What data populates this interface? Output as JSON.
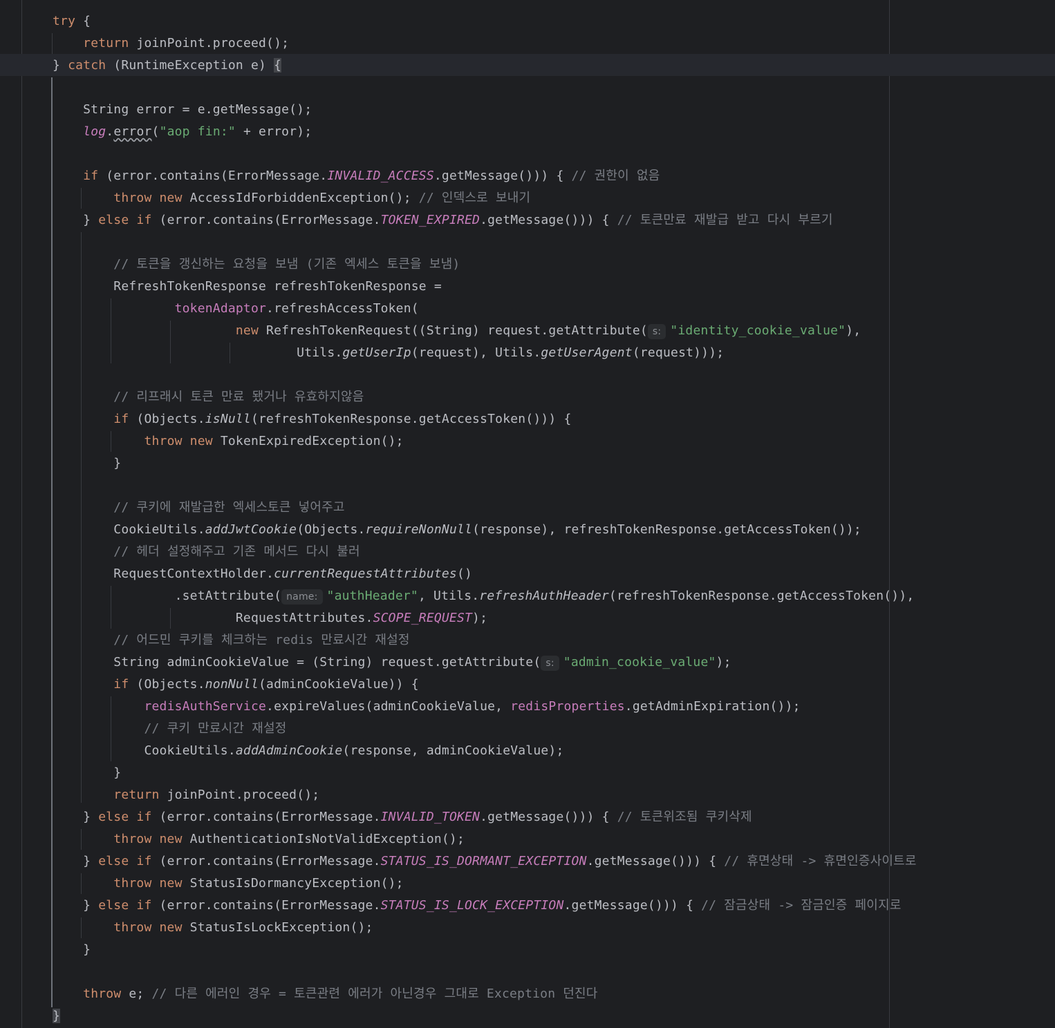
{
  "lines": [
    [
      {
        "t": "try",
        "c": "kw"
      },
      {
        "t": " {"
      }
    ],
    [
      {
        "t": "    "
      },
      {
        "t": "return",
        "c": "kw"
      },
      {
        "t": " joinPoint.proceed();"
      }
    ],
    [
      {
        "t": "} "
      },
      {
        "t": "catch",
        "c": "kw"
      },
      {
        "t": " (RuntimeException e) "
      },
      {
        "t": "{",
        "c": "brace-hl"
      }
    ],
    [],
    [
      {
        "t": "    String error = e.getMessage();"
      }
    ],
    [
      {
        "t": "    "
      },
      {
        "t": "log",
        "c": "stat"
      },
      {
        "t": "."
      },
      {
        "t": "error",
        "c": "wavy"
      },
      {
        "t": "("
      },
      {
        "t": "\"aop fin:\"",
        "c": "str"
      },
      {
        "t": " + error);"
      }
    ],
    [],
    [
      {
        "t": "    "
      },
      {
        "t": "if",
        "c": "kw"
      },
      {
        "t": " (error.contains(ErrorMessage."
      },
      {
        "t": "INVALID_ACCESS",
        "c": "stat"
      },
      {
        "t": ".getMessage())) { "
      },
      {
        "t": "// 권한이 없음",
        "c": "cmt"
      }
    ],
    [
      {
        "t": "        "
      },
      {
        "t": "throw new",
        "c": "kw"
      },
      {
        "t": " AccessIdForbiddenException(); "
      },
      {
        "t": "// 인덱스로 보내기",
        "c": "cmt"
      }
    ],
    [
      {
        "t": "    } "
      },
      {
        "t": "else if",
        "c": "kw"
      },
      {
        "t": " (error.contains(ErrorMessage."
      },
      {
        "t": "TOKEN_EXPIRED",
        "c": "stat"
      },
      {
        "t": ".getMessage())) { "
      },
      {
        "t": "// 토큰만료 재발급 받고 다시 부르기",
        "c": "cmt"
      }
    ],
    [],
    [
      {
        "t": "        "
      },
      {
        "t": "// 토큰을 갱신하는 요청을 보냄 (기존 엑세스 토큰을 보냄)",
        "c": "cmt"
      }
    ],
    [
      {
        "t": "        RefreshTokenResponse refreshTokenResponse ="
      }
    ],
    [
      {
        "t": "                "
      },
      {
        "t": "tokenAdaptor",
        "c": "fld"
      },
      {
        "t": ".refreshAccessToken("
      }
    ],
    [
      {
        "t": "                        "
      },
      {
        "t": "new",
        "c": "kw"
      },
      {
        "t": " RefreshTokenRequest((String) request.getAttribute("
      },
      {
        "t": "s:",
        "c": "hint"
      },
      {
        "t": "\"identity_cookie_value\"",
        "c": "str"
      },
      {
        "t": "),"
      }
    ],
    [
      {
        "t": "                                Utils."
      },
      {
        "t": "getUserIp",
        "c": "ist"
      },
      {
        "t": "(request), Utils."
      },
      {
        "t": "getUserAgent",
        "c": "ist"
      },
      {
        "t": "(request)));"
      }
    ],
    [],
    [
      {
        "t": "        "
      },
      {
        "t": "// 리프래시 토큰 만료 됐거나 유효하지않음",
        "c": "cmt"
      }
    ],
    [
      {
        "t": "        "
      },
      {
        "t": "if",
        "c": "kw"
      },
      {
        "t": " (Objects."
      },
      {
        "t": "isNull",
        "c": "ist"
      },
      {
        "t": "(refreshTokenResponse.getAccessToken())) {"
      }
    ],
    [
      {
        "t": "            "
      },
      {
        "t": "throw new",
        "c": "kw"
      },
      {
        "t": " TokenExpiredException();"
      }
    ],
    [
      {
        "t": "        }"
      }
    ],
    [],
    [
      {
        "t": "        "
      },
      {
        "t": "// 쿠키에 재발급한 엑세스토큰 넣어주고",
        "c": "cmt"
      }
    ],
    [
      {
        "t": "        CookieUtils."
      },
      {
        "t": "addJwtCookie",
        "c": "ist"
      },
      {
        "t": "(Objects."
      },
      {
        "t": "requireNonNull",
        "c": "ist"
      },
      {
        "t": "(response), refreshTokenResponse.getAccessToken());"
      }
    ],
    [
      {
        "t": "        "
      },
      {
        "t": "// 헤더 설정해주고 기존 메서드 다시 불러",
        "c": "cmt"
      }
    ],
    [
      {
        "t": "        RequestContextHolder."
      },
      {
        "t": "currentRequestAttributes",
        "c": "ist"
      },
      {
        "t": "()"
      }
    ],
    [
      {
        "t": "                .setAttribute("
      },
      {
        "t": "name:",
        "c": "hint"
      },
      {
        "t": "\"authHeader\"",
        "c": "str"
      },
      {
        "t": ", Utils."
      },
      {
        "t": "refreshAuthHeader",
        "c": "ist"
      },
      {
        "t": "(refreshTokenResponse.getAccessToken()),"
      }
    ],
    [
      {
        "t": "                        RequestAttributes."
      },
      {
        "t": "SCOPE_REQUEST",
        "c": "stat"
      },
      {
        "t": ");"
      }
    ],
    [
      {
        "t": "        "
      },
      {
        "t": "// 어드민 쿠키를 체크하는 redis 만료시간 재설정",
        "c": "cmt"
      }
    ],
    [
      {
        "t": "        String adminCookieValue = (String) request.getAttribute("
      },
      {
        "t": "s:",
        "c": "hint"
      },
      {
        "t": "\"admin_cookie_value\"",
        "c": "str"
      },
      {
        "t": ");"
      }
    ],
    [
      {
        "t": "        "
      },
      {
        "t": "if",
        "c": "kw"
      },
      {
        "t": " (Objects."
      },
      {
        "t": "nonNull",
        "c": "ist"
      },
      {
        "t": "(adminCookieValue)) {"
      }
    ],
    [
      {
        "t": "            "
      },
      {
        "t": "redisAuthService",
        "c": "fld"
      },
      {
        "t": ".expireValues(adminCookieValue, "
      },
      {
        "t": "redisProperties",
        "c": "fld"
      },
      {
        "t": ".getAdminExpiration());"
      }
    ],
    [
      {
        "t": "            "
      },
      {
        "t": "// 쿠키 만료시간 재설정",
        "c": "cmt"
      }
    ],
    [
      {
        "t": "            CookieUtils."
      },
      {
        "t": "addAdminCookie",
        "c": "ist"
      },
      {
        "t": "(response, adminCookieValue);"
      }
    ],
    [
      {
        "t": "        }"
      }
    ],
    [
      {
        "t": "        "
      },
      {
        "t": "return",
        "c": "kw"
      },
      {
        "t": " joinPoint.proceed();"
      }
    ],
    [
      {
        "t": "    } "
      },
      {
        "t": "else if",
        "c": "kw"
      },
      {
        "t": " (error.contains(ErrorMessage."
      },
      {
        "t": "INVALID_TOKEN",
        "c": "stat"
      },
      {
        "t": ".getMessage())) { "
      },
      {
        "t": "// 토큰위조됨 쿠키삭제",
        "c": "cmt"
      }
    ],
    [
      {
        "t": "        "
      },
      {
        "t": "throw new",
        "c": "kw"
      },
      {
        "t": " AuthenticationIsNotValidException();"
      }
    ],
    [
      {
        "t": "    } "
      },
      {
        "t": "else if",
        "c": "kw"
      },
      {
        "t": " (error.contains(ErrorMessage."
      },
      {
        "t": "STATUS_IS_DORMANT_EXCEPTION",
        "c": "stat"
      },
      {
        "t": ".getMessage())) { "
      },
      {
        "t": "// 휴면상태 -> 휴면인증사이트로",
        "c": "cmt"
      }
    ],
    [
      {
        "t": "        "
      },
      {
        "t": "throw new",
        "c": "kw"
      },
      {
        "t": " StatusIsDormancyException();"
      }
    ],
    [
      {
        "t": "    } "
      },
      {
        "t": "else if",
        "c": "kw"
      },
      {
        "t": " (error.contains(ErrorMessage."
      },
      {
        "t": "STATUS_IS_LOCK_EXCEPTION",
        "c": "stat"
      },
      {
        "t": ".getMessage())) { "
      },
      {
        "t": "// 잠금상태 -> 잠금인증 페이지로",
        "c": "cmt"
      }
    ],
    [
      {
        "t": "        "
      },
      {
        "t": "throw new",
        "c": "kw"
      },
      {
        "t": " StatusIsLockException();"
      }
    ],
    [
      {
        "t": "    }"
      }
    ],
    [],
    [
      {
        "t": "    "
      },
      {
        "t": "throw",
        "c": "kw"
      },
      {
        "t": " e; "
      },
      {
        "t": "// 다른 에러인 경우 = 토큰관련 에러가 아닌경우 그대로 Exception 던진다",
        "c": "cmt"
      }
    ],
    [
      {
        "t": "}",
        "c": "brace-hl"
      }
    ]
  ],
  "colors": {
    "background": "#1e1f22",
    "keyword": "#cf8e6d",
    "string": "#6aab73",
    "comment": "#7a7e85",
    "field": "#c77dbb",
    "text": "#bcbec4"
  }
}
